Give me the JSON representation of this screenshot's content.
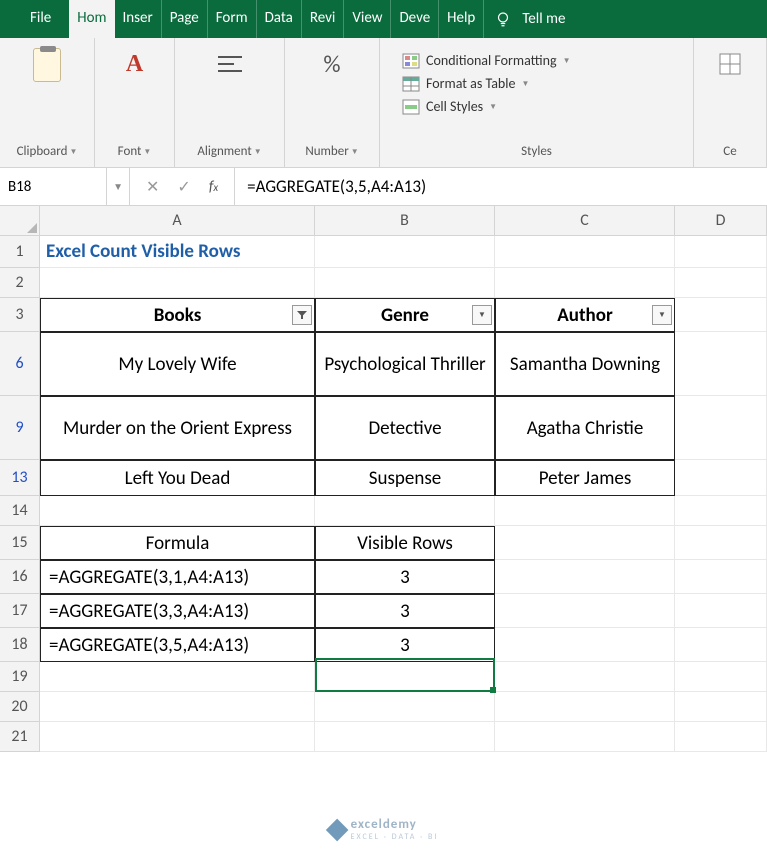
{
  "tabs": {
    "file": "File",
    "home": "Hom",
    "insert": "Inser",
    "page": "Page",
    "formulas": "Form",
    "data": "Data",
    "review": "Revi",
    "view": "View",
    "developer": "Deve",
    "help": "Help",
    "tellme": "Tell me"
  },
  "ribbon": {
    "clipboard": "Clipboard",
    "font": "Font",
    "alignment": "Alignment",
    "number": "Number",
    "cond_fmt": "Conditional Formatting",
    "fmt_table": "Format as Table",
    "cell_styles": "Cell Styles",
    "styles": "Styles",
    "cells": "Ce"
  },
  "namebox": "B18",
  "formula": "=AGGREGATE(3,5,A4:A13)",
  "columns": [
    "A",
    "B",
    "C",
    "D"
  ],
  "title": "Excel Count Visible Rows",
  "headers": {
    "books": "Books",
    "genre": "Genre",
    "author": "Author"
  },
  "data_rows": [
    {
      "num": "6",
      "book": "My Lovely Wife",
      "genre": "Psychological Thriller",
      "author": "Samantha Downing"
    },
    {
      "num": "9",
      "book": "Murder on the Orient Express",
      "genre": "Detective",
      "author": "Agatha Christie"
    },
    {
      "num": "13",
      "book": "Left You Dead",
      "genre": "Suspense",
      "author": "Peter James"
    }
  ],
  "formula_table": {
    "h1": "Formula",
    "h2": "Visible Rows",
    "rows": [
      {
        "num": "16",
        "f": "=AGGREGATE(3,1,A4:A13)",
        "v": "3"
      },
      {
        "num": "17",
        "f": "=AGGREGATE(3,3,A4:A13)",
        "v": "3"
      },
      {
        "num": "18",
        "f": "=AGGREGATE(3,5,A4:A13)",
        "v": "3"
      }
    ]
  },
  "empty_rows": [
    "19",
    "20",
    "21"
  ],
  "watermark": "exceldemy"
}
